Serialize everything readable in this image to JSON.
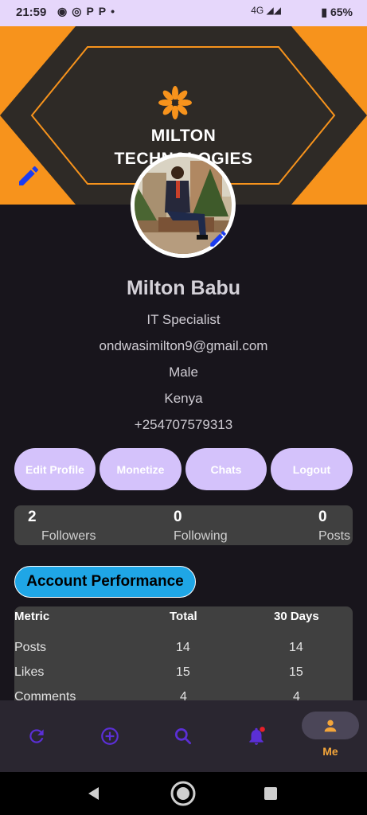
{
  "status_bar": {
    "time": "21:59",
    "notification_icons": [
      "messenger-icon",
      "whatsapp-icon",
      "p-icon",
      "p-icon",
      "dot-icon"
    ],
    "network": "4G",
    "battery": "65%"
  },
  "banner": {
    "title_line1": "MILTON",
    "title_line2": "TECHNOLOGIES",
    "bg_color": "#f7931c",
    "hex_color": "#2e2a26"
  },
  "profile": {
    "name": "Milton Babu",
    "title": "IT Specialist",
    "email": "ondwasimilton9@gmail.com",
    "gender": "Male",
    "country": "Kenya",
    "phone": "+254707579313"
  },
  "actions": {
    "edit_profile": "Edit Profile",
    "monetize": "Monetize",
    "chats": "Chats",
    "logout": "Logout"
  },
  "stats": {
    "followers_count": "2",
    "followers_label": "Followers",
    "following_count": "0",
    "following_label": "Following",
    "posts_count": "0",
    "posts_label": "Posts"
  },
  "performance": {
    "button_label": "Account Performance",
    "headers": {
      "metric": "Metric",
      "total": "Total",
      "days": "30 Days"
    },
    "rows": [
      {
        "metric": "Posts",
        "total": "14",
        "days": "14"
      },
      {
        "metric": "Likes",
        "total": "15",
        "days": "15"
      },
      {
        "metric": "Comments",
        "total": "4",
        "days": "4"
      }
    ]
  },
  "bottom_nav": {
    "items": [
      "refresh-icon",
      "add-icon",
      "search-icon",
      "notification-icon",
      "person-icon"
    ],
    "me_label": "Me",
    "accent": "#5b2fd6",
    "active_color": "#f3a53a"
  }
}
